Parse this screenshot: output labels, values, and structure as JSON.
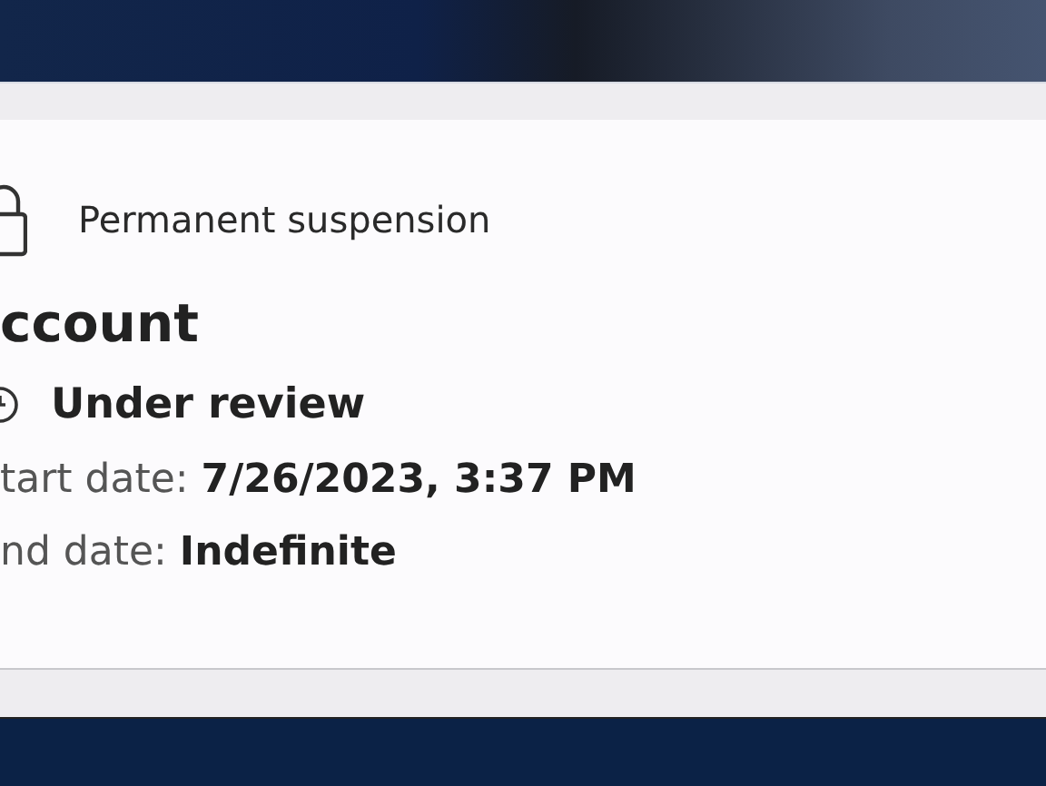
{
  "notice": {
    "label": "Permanent suspension"
  },
  "account": {
    "title": "ccount",
    "status": "Under review",
    "fields": [
      {
        "label": "tart date:",
        "value": "7/26/2023, 3:37 PM"
      },
      {
        "label": "nd date:",
        "value": "Indefinite"
      }
    ]
  }
}
